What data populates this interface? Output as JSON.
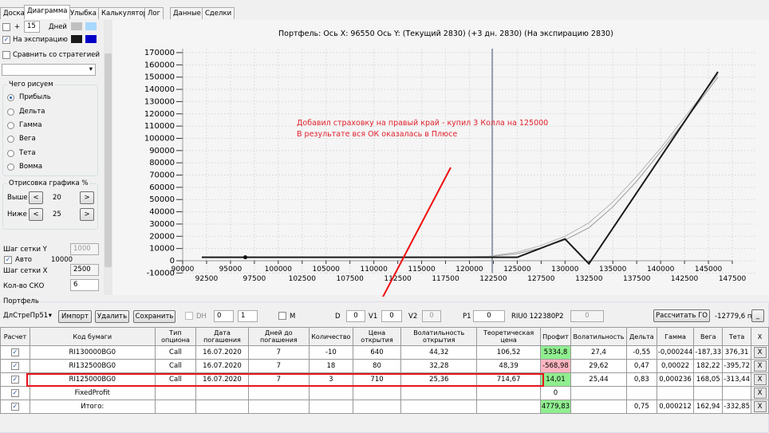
{
  "tabs": [
    "Доска",
    "Диаграмма",
    "Улыбка",
    "Калькулятор",
    "Лог",
    "Данные",
    "Сделки"
  ],
  "left": {
    "days_value": "15",
    "days_label": "Дней",
    "plus": "+",
    "expiry_label": "На экспирацию",
    "compare_label": "Сравнить со стратегией",
    "swatches": {
      "days_a": "#c0c0c0",
      "days_b": "#a8d8ff",
      "expiry_a": "#1a1a1a",
      "expiry_b": "#0000c8"
    },
    "draw_group": "Чего рисуем",
    "radios": [
      "Прибыль",
      "Дельта",
      "Гамма",
      "Вега",
      "Тета",
      "Вомма"
    ],
    "render_group": "Отрисовка графика %",
    "above_label": "Выше",
    "above_value": "20",
    "below_label": "Ниже",
    "below_value": "25",
    "prev": "<",
    "next": ">",
    "grid_y_label": "Шаг сетки Y",
    "grid_y_value": "1000",
    "auto_label": "Авто",
    "auto_value": "10000",
    "grid_x_label": "Шаг сетки X",
    "grid_x_value": "2500",
    "sko_label": "Кол-во СКО",
    "sko_value": "6"
  },
  "chart_data": {
    "type": "line",
    "title": "Портфель: Ось X: 96550 Ось Y:  (Текущий 2830)  (+3 дн. 2830)  (На экспирацию 2830)",
    "xlim": [
      90000,
      147500
    ],
    "ylim": [
      -10000,
      170000
    ],
    "x_ticks_upper": [
      90000,
      95000,
      100000,
      105000,
      110000,
      115000,
      120000,
      125000,
      130000,
      135000,
      140000,
      145000
    ],
    "x_ticks_lower": [
      92500,
      97500,
      102500,
      107500,
      112500,
      117500,
      122500,
      127500,
      132500,
      137500,
      142500,
      147500
    ],
    "y_ticks": [
      170000,
      160000,
      150000,
      140000,
      130000,
      120000,
      110000,
      100000,
      90000,
      80000,
      70000,
      60000,
      50000,
      40000,
      30000,
      20000,
      10000,
      0,
      -10000
    ],
    "grid": true,
    "current_price_line": 122380,
    "marker": [
      96550,
      2830
    ],
    "series": [
      {
        "color": "#999999",
        "points": [
          [
            92000,
            2830
          ],
          [
            118000,
            2900
          ],
          [
            122000,
            3300
          ],
          [
            125000,
            5800
          ],
          [
            127500,
            10500
          ],
          [
            130000,
            17000
          ],
          [
            132500,
            27000
          ],
          [
            135000,
            44000
          ],
          [
            137500,
            65000
          ],
          [
            140000,
            89000
          ],
          [
            142500,
            114000
          ],
          [
            146000,
            150000
          ]
        ]
      },
      {
        "color": "#b5b5b5",
        "points": [
          [
            92000,
            2830
          ],
          [
            118000,
            2950
          ],
          [
            122000,
            3700
          ],
          [
            125000,
            7000
          ],
          [
            127500,
            12500
          ],
          [
            130000,
            20000
          ],
          [
            132500,
            31000
          ],
          [
            135000,
            48000
          ],
          [
            137500,
            69000
          ],
          [
            140000,
            92000
          ],
          [
            142500,
            117000
          ],
          [
            146000,
            152000
          ]
        ]
      },
      {
        "color": "#1a1a1a",
        "points": [
          [
            92000,
            2830
          ],
          [
            125000,
            2830
          ],
          [
            130000,
            17830
          ],
          [
            132500,
            -2500
          ],
          [
            146000,
            154330
          ]
        ]
      }
    ],
    "annotation": [
      "Добавил страховку на правый край - купил 3 Колла на 125000",
      "В результате вся ОК оказалась в Плюсе"
    ]
  },
  "portfolio": {
    "title": "Портфель",
    "combo": "ДлСтреПр51",
    "import": "Импорт",
    "delete": "Удалить",
    "save": "Сохранить",
    "dh": "DH",
    "spin1": "0",
    "spin2": "1",
    "m": "M",
    "d_label": "D",
    "d_value": "0",
    "v1_label": "V1",
    "v1_value": "0",
    "v2_label": "V2",
    "v2_value": "0",
    "p1_label": "P1",
    "p1_value": "0",
    "price_label": "RIU0 122380",
    "p2_label": "P2",
    "p2_value": "0",
    "calc_go": "Рассчитать ГО",
    "go_value": "-12779,6 п.",
    "min_btn": "_"
  },
  "table": {
    "headers": [
      "Расчет",
      "Код бумаги",
      "Тип опциона",
      "Дата погашения",
      "Дней до погашения",
      "Количество",
      "Цена открытия",
      "Волатильность открытия",
      "Теоретическая цена",
      "Профит",
      "Волатильность",
      "Дельта",
      "Гамма",
      "Вега",
      "Тета",
      "X"
    ],
    "rows": [
      [
        "",
        "RI130000BG0",
        "Call",
        "16.07.2020",
        "7",
        "-10",
        "640",
        "44,32",
        "106,52",
        "5334,8",
        "27,4",
        "-0,55",
        "-0,000244",
        "-187,33",
        "376,31",
        "X"
      ],
      [
        "",
        "RI132500BG0",
        "Call",
        "16.07.2020",
        "7",
        "18",
        "80",
        "32,28",
        "48,39",
        "-568,98",
        "29,62",
        "0,47",
        "0,00022",
        "182,22",
        "-395,72",
        "X"
      ],
      [
        "",
        "RI125000BG0",
        "Call",
        "16.07.2020",
        "7",
        "3",
        "710",
        "25,36",
        "714,67",
        "14,01",
        "25,44",
        "0,83",
        "0,000236",
        "168,05",
        "-313,44",
        "X"
      ],
      [
        "",
        "FixedProfit",
        "",
        "",
        "",
        "",
        "",
        "",
        "",
        "0",
        "",
        "",
        "",
        "",
        "",
        "X"
      ],
      [
        "",
        "Итого:",
        "",
        "",
        "",
        "",
        "",
        "",
        "",
        "4779,83",
        "",
        "0,75",
        "0,000212",
        "162,94",
        "-332,85",
        "X"
      ]
    ]
  }
}
